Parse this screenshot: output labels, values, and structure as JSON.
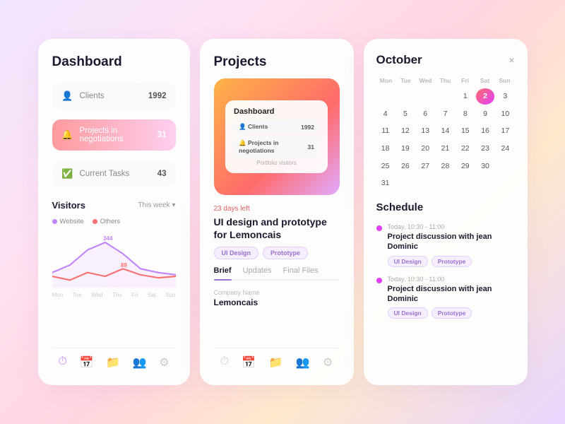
{
  "dashboard": {
    "title": "Dashboard",
    "stats": [
      {
        "id": "clients",
        "label": "Clients",
        "value": "1992",
        "highlight": false,
        "icon": "👤"
      },
      {
        "id": "negotiations",
        "label": "Projects in negotiations",
        "value": "31",
        "highlight": true,
        "icon": "🔔"
      },
      {
        "id": "tasks",
        "label": "Current Tasks",
        "value": "43",
        "highlight": false,
        "icon": "✅"
      }
    ],
    "visitors": {
      "title": "Visitors",
      "filter": "This week",
      "legend": [
        {
          "label": "Website",
          "color": "#c084fc"
        },
        {
          "label": "Others",
          "color": "#f87171"
        }
      ],
      "peak1": "344",
      "peak2": "89",
      "days": [
        "Mon",
        "Tue",
        "Wed",
        "Thu",
        "Fri",
        "Sat",
        "Sun"
      ]
    },
    "nav": [
      "⏱",
      "📅",
      "📁",
      "👥",
      "⚙"
    ]
  },
  "projects": {
    "title": "Projects",
    "preview": {
      "inner_title": "Dashboard",
      "rows": [
        {
          "label": "Clients",
          "value": "1992"
        },
        {
          "label": "Projects in negotiations",
          "value": "31"
        }
      ],
      "footer": "Portfolio visitors"
    },
    "days_left": "23 days left",
    "project_name": "UI design and prototype for Lemoncais",
    "tags": [
      "UI Design",
      "Prototype"
    ],
    "tabs": [
      {
        "label": "Brief",
        "active": true
      },
      {
        "label": "Updates",
        "active": false
      },
      {
        "label": "Final Files",
        "active": false
      }
    ],
    "field_label": "Company Name",
    "field_value": "Lemoncais",
    "nav": [
      "⏱",
      "📅",
      "📁",
      "👥",
      "⚙"
    ]
  },
  "calendar": {
    "title": "October",
    "close": "×",
    "day_names": [
      "Mon",
      "Tue",
      "Wed",
      "Thu",
      "Fri",
      "Sat",
      "Sun"
    ],
    "weeks": [
      [
        "",
        "",
        "",
        "",
        "1",
        "2",
        "3"
      ],
      [
        "",
        "4",
        "5",
        "6",
        "7",
        "8",
        "9"
      ],
      [
        "",
        "10",
        "11",
        "12",
        "13",
        "14",
        "15"
      ],
      [
        "",
        "16",
        "17",
        "18",
        "19",
        "20",
        "21"
      ],
      [
        "22",
        "23",
        "24",
        "25",
        "26",
        "27",
        "28"
      ],
      [
        "29",
        "30",
        "31",
        "",
        "",
        "",
        ""
      ]
    ],
    "today": "2",
    "schedule": {
      "title": "Schedule",
      "items": [
        {
          "time": "Today, 10:30 - 11:00",
          "name": "Project discussion with jean Dominic",
          "tags": [
            "UI Design",
            "Prototype"
          ]
        },
        {
          "time": "Today, 10:30 - 11:00",
          "name": "Project discussion with jean Dominic",
          "tags": [
            "UI Design",
            "Prototype"
          ]
        }
      ]
    }
  }
}
